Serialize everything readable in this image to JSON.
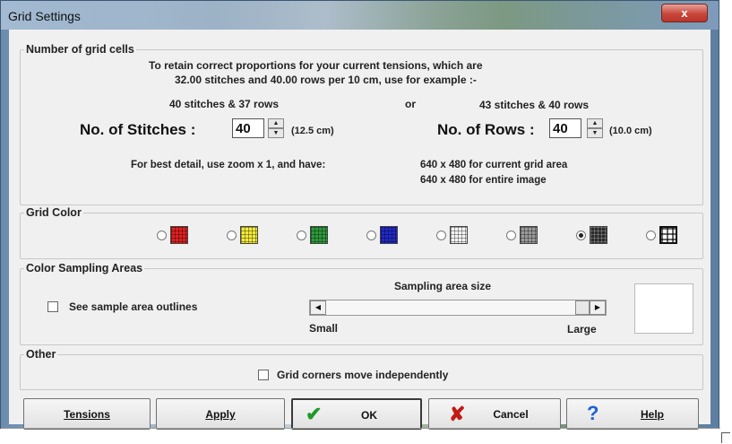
{
  "window": {
    "title": "Grid Settings",
    "close_glyph": "x"
  },
  "grid_cells": {
    "legend": "Number of grid cells",
    "info_line1": "To retain correct proportions for your current tensions, which are",
    "info_line2": "32.00 stitches and 40.00 rows per 10 cm, use for example :-",
    "example_left": "40 stitches & 37 rows",
    "example_or": "or",
    "example_right": "43 stitches & 40 rows",
    "stitches_label": "No. of Stitches :",
    "stitches_value": "40",
    "stitches_cm": "(12.5 cm)",
    "rows_label": "No. of Rows :",
    "rows_value": "40",
    "rows_cm": "(10.0 cm)",
    "detail_prefix": "For best detail, use zoom x 1, and have:",
    "detail_current": "640 x 480 for current grid area",
    "detail_entire": "640 x 480 for entire image"
  },
  "grid_color": {
    "legend": "Grid Color",
    "options": [
      {
        "icon": "red-grid-icon",
        "color": "#e02020",
        "selected": false
      },
      {
        "icon": "yellow-grid-icon",
        "color": "#f2ea3a",
        "selected": false
      },
      {
        "icon": "green-grid-icon",
        "color": "#2e9a3c",
        "selected": false
      },
      {
        "icon": "blue-grid-icon",
        "color": "#2028c8",
        "selected": false
      },
      {
        "icon": "white-grid-icon",
        "color": "#f4f4f4",
        "selected": false
      },
      {
        "icon": "gray-grid-icon",
        "color": "#9a9a9a",
        "selected": false
      },
      {
        "icon": "black-grid-icon",
        "color": "#2a2a2a",
        "selected": true
      },
      {
        "icon": "black-white-grid-icon",
        "color": "#ffffff",
        "selected": false
      }
    ]
  },
  "sampling": {
    "legend": "Color Sampling Areas",
    "outline_checkbox_label": "See sample area outlines",
    "outline_checked": false,
    "size_label": "Sampling area size",
    "small_label": "Small",
    "large_label": "Large",
    "slider_level": 1.0
  },
  "other": {
    "legend": "Other",
    "corners_checkbox_label": "Grid corners move independently",
    "corners_checked": false
  },
  "buttons": {
    "tensions": "Tensions",
    "apply": "Apply",
    "ok": "OK",
    "cancel": "Cancel",
    "help": "Help"
  }
}
